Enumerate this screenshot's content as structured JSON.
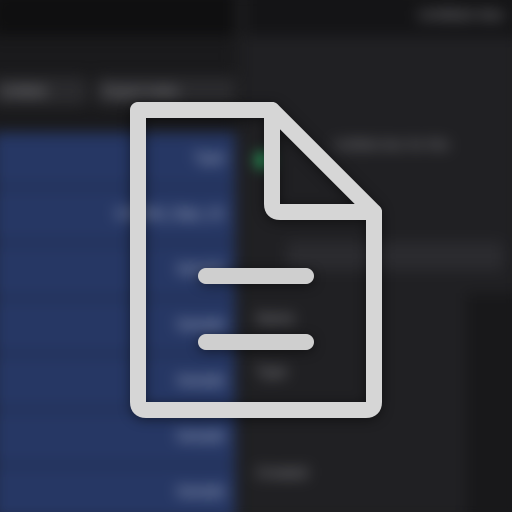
{
  "window": {
    "title": "Untitled doc"
  },
  "toolbar": {
    "button_one": "Untitled",
    "button_two": "Export notes"
  },
  "list": {
    "rows": [
      {
        "key": "",
        "name": "Type"
      },
      {
        "key": "",
        "name": "Untitled_Sign_01"
      },
      {
        "key": "",
        "name": "Sample"
      },
      {
        "key": "",
        "name": "Sample"
      },
      {
        "key": "",
        "name": "Sample"
      },
      {
        "key": "",
        "name": "Sample"
      },
      {
        "key": "",
        "name": "Sample"
      }
    ]
  },
  "panel": {
    "description": "Untitled doc for this",
    "label_name": "Name",
    "label_type": "Type",
    "label_created": "Created"
  },
  "icons": {
    "foreground": "document-icon"
  },
  "colors": {
    "icon_stroke": "#d6d6d6",
    "status_dot": "#2ecc71",
    "list_selection": "#263764"
  }
}
